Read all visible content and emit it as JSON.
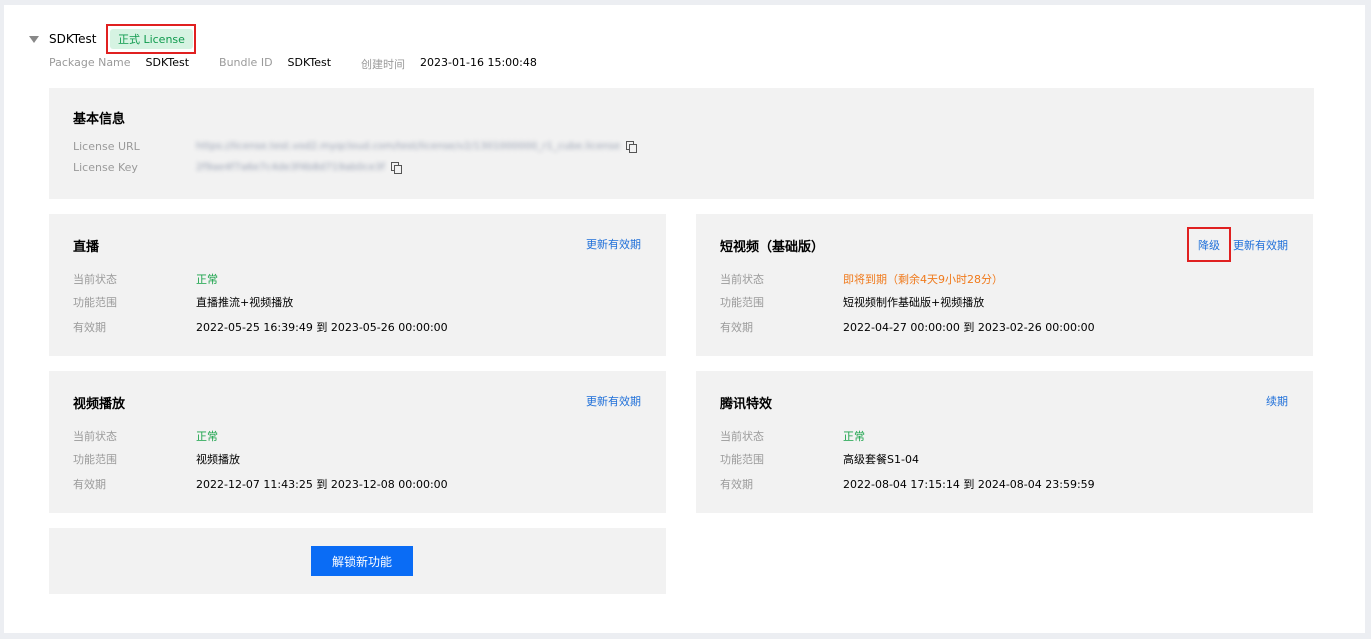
{
  "app": {
    "name": "SDKTest",
    "badge": "正式 License",
    "meta": [
      {
        "label": "Package Name",
        "value": "SDKTest"
      },
      {
        "label": "Bundle ID",
        "value": "SDKTest"
      },
      {
        "label": "创建时间",
        "value": "2023-01-16 15:00:48"
      }
    ]
  },
  "basic": {
    "title": "基本信息",
    "url_label": "License URL",
    "url_value": "https://license.test.vod2.myqcloud.com/test/license/v2/1301000000_r1_cube.license",
    "key_label": "License Key",
    "key_value": "2f9ae4f7a6e7c4de3f4b8d719ab0ce3f"
  },
  "cards": [
    {
      "title": "直播",
      "actions": [
        "更新有效期"
      ],
      "status_label": "当前状态",
      "status": "正常",
      "scope_label": "功能范围",
      "scope": "直播推流+视频播放",
      "period_label": "有效期",
      "period": "2022-05-25 16:39:49 到 2023-05-26 00:00:00"
    },
    {
      "title": "短视频（基础版）",
      "actions": [
        "降级",
        "更新有效期"
      ],
      "status_label": "当前状态",
      "status": "即将到期（剩余4天9小时28分）",
      "scope_label": "功能范围",
      "scope": "短视频制作基础版+视频播放",
      "period_label": "有效期",
      "period": "2022-04-27 00:00:00 到 2023-02-26 00:00:00"
    },
    {
      "title": "视频播放",
      "actions": [
        "更新有效期"
      ],
      "status_label": "当前状态",
      "status": "正常",
      "scope_label": "功能范围",
      "scope": "视频播放",
      "period_label": "有效期",
      "period": "2022-12-07 11:43:25 到 2023-12-08 00:00:00"
    },
    {
      "title": "腾讯特效",
      "actions": [
        "续期"
      ],
      "status_label": "当前状态",
      "status": "正常",
      "scope_label": "功能范围",
      "scope": "高级套餐S1-04",
      "period_label": "有效期",
      "period": "2022-08-04 17:15:14 到 2024-08-04 23:59:59"
    }
  ],
  "unlock_button": "解锁新功能",
  "colors": {
    "accent": "#0a6cf5",
    "link": "#1e6fd9",
    "ok": "#1aa34a",
    "warn": "#f07a1c",
    "highlight": "#e02020"
  }
}
